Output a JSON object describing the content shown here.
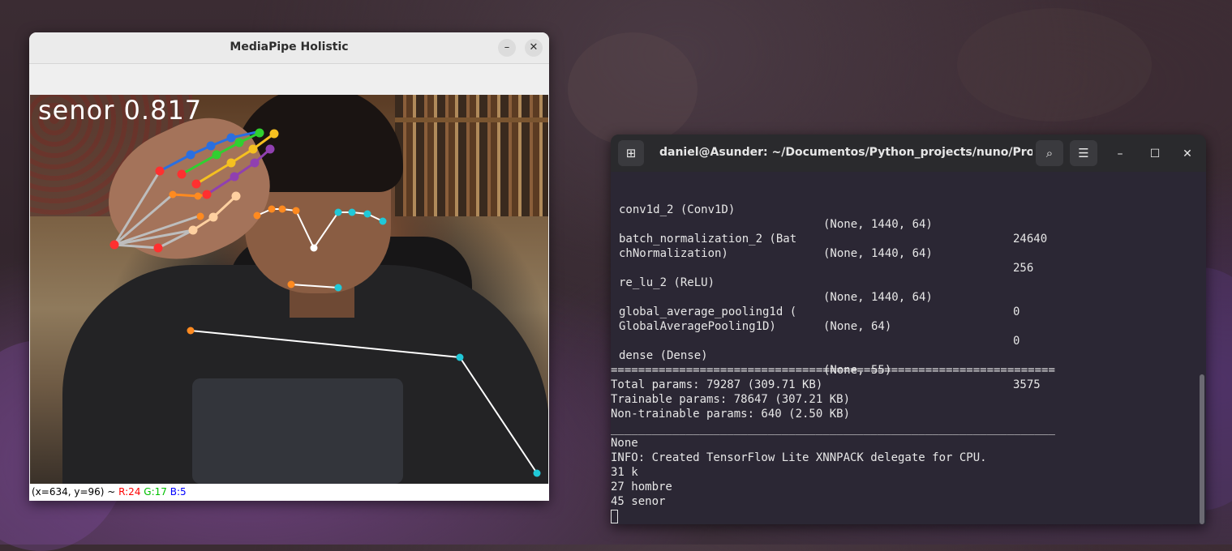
{
  "holistic_window": {
    "title": "MediaPipe Holistic",
    "minimize_icon": "minimize-icon",
    "close_icon": "close-icon",
    "prediction_label": "senor 0.817",
    "status": {
      "coords": "(x=634, y=96) ~ ",
      "r": "R:24",
      "g": "G:17",
      "b": "B:5",
      "colors": {
        "r": "#ff0000",
        "g": "#00c000",
        "b": "#0000ff"
      }
    }
  },
  "terminal": {
    "title": "daniel@Asunder: ~/Documentos/Python_projects/nuno/Pro...",
    "icons": {
      "new_tab": "new-tab-icon",
      "search": "search-icon",
      "menu": "hamburger-menu-icon",
      "minimize": "minimize-icon",
      "maximize": "maximize-icon",
      "close": "close-icon"
    },
    "layers": [
      {
        "name": "conv1d_2 (Conv1D)",
        "shape": "(None, 1440, 64)",
        "params": "24640"
      },
      {
        "name": "batch_normalization_2 (Bat\nchNormalization)",
        "shape": "(None, 1440, 64)",
        "params": "256"
      },
      {
        "name": "re_lu_2 (ReLU)",
        "shape": "(None, 1440, 64)",
        "params": "0"
      },
      {
        "name": "global_average_pooling1d (\nGlobalAveragePooling1D)",
        "shape": "(None, 64)",
        "params": "0"
      },
      {
        "name": "dense (Dense)",
        "shape": "(None, 55)",
        "params": "3575"
      }
    ],
    "separator_double": "=================================================================",
    "summary": [
      "Total params: 79287 (309.71 KB)",
      "Trainable params: 78647 (307.21 KB)",
      "Non-trainable params: 640 (2.50 KB)"
    ],
    "separator_single": "_________________________________________________________________",
    "output": [
      "None",
      "INFO: Created TensorFlow Lite XNNPACK delegate for CPU.",
      "31 k",
      "27 hombre",
      "45 senor"
    ]
  }
}
